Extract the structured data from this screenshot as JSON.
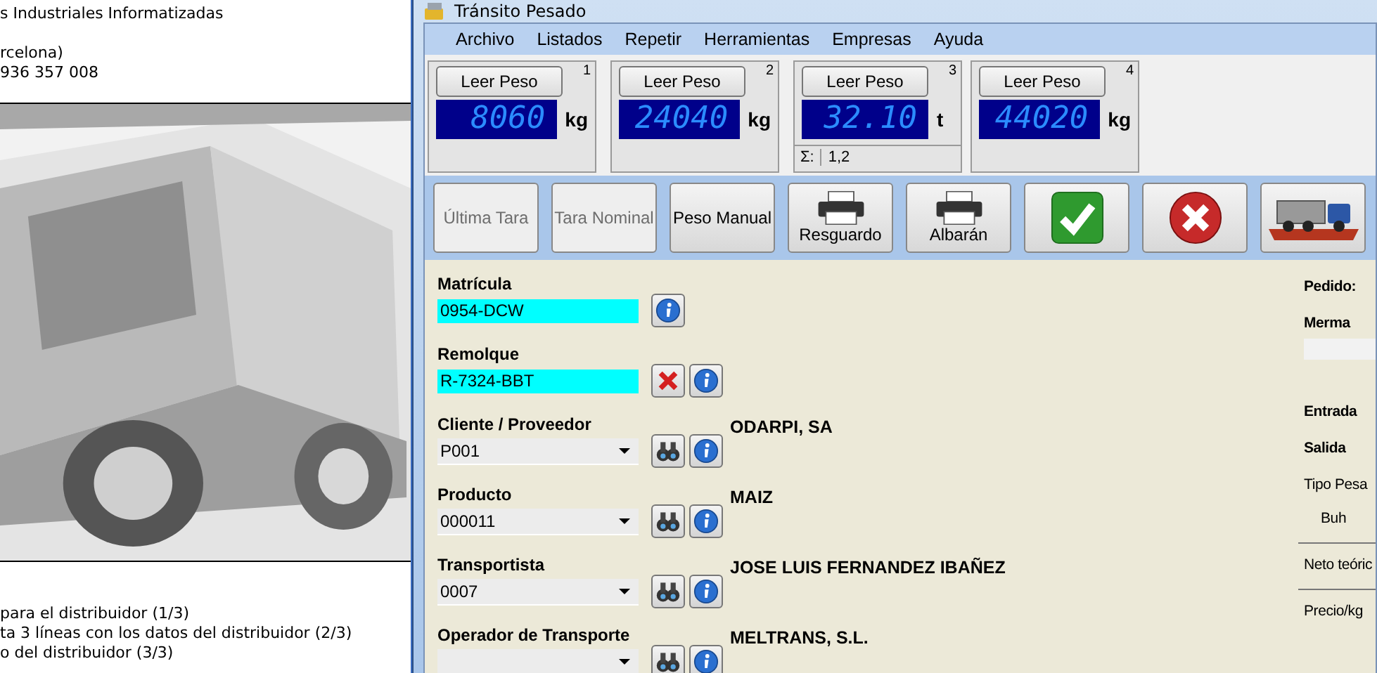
{
  "background_window": {
    "header_lines": [
      "s Industriales Informatizadas",
      "rcelona)",
      "936 357 008"
    ],
    "footer_lines": [
      "para el distribuidor (1/3)",
      "ta 3 líneas con los datos del distribuidor (2/3)",
      "o del distribuidor (3/3)"
    ]
  },
  "window": {
    "title": "Tránsito Pesado"
  },
  "menu": [
    "Archivo",
    "Listados",
    "Repetir",
    "Herramientas",
    "Empresas",
    "Ayuda"
  ],
  "scales": [
    {
      "number": "1",
      "button": "Leer Peso",
      "value": "8060",
      "unit": "kg"
    },
    {
      "number": "2",
      "button": "Leer Peso",
      "value": "24040",
      "unit": "kg"
    },
    {
      "number": "3",
      "button": "Leer Peso",
      "value": "32.10",
      "unit": "t",
      "sum_label": "Σ:",
      "sum_value": "1,2"
    },
    {
      "number": "4",
      "button": "Leer Peso",
      "value": "44020",
      "unit": "kg"
    }
  ],
  "toolbar": [
    {
      "kind": "text",
      "label": "Última Tara",
      "disabled": true
    },
    {
      "kind": "text",
      "label": "Tara Nominal",
      "disabled": true
    },
    {
      "kind": "text",
      "label": "Peso Manual",
      "disabled": false
    },
    {
      "kind": "printer",
      "label": "Resguardo",
      "disabled": false
    },
    {
      "kind": "printer",
      "label": "Albarán",
      "disabled": false
    },
    {
      "kind": "accept",
      "disabled": false
    },
    {
      "kind": "cancel",
      "disabled": false
    },
    {
      "kind": "truck",
      "disabled": false
    }
  ],
  "form": [
    {
      "label": "Matrícula",
      "kind": "plate",
      "value": "0954-DCW",
      "actions": [
        {
          "kind": "info"
        }
      ]
    },
    {
      "label": "Remolque",
      "kind": "plate",
      "value": "R-7324-BBT",
      "actions": [
        {
          "kind": "clear"
        },
        {
          "kind": "info"
        }
      ]
    },
    {
      "label": "Cliente / Proveedor",
      "kind": "combo",
      "value": "P001",
      "actions": [
        {
          "kind": "search"
        },
        {
          "kind": "info"
        }
      ],
      "description": "ODARPI, SA"
    },
    {
      "label": "Producto",
      "kind": "combo",
      "value": "000011",
      "actions": [
        {
          "kind": "search"
        },
        {
          "kind": "info"
        }
      ],
      "description": "MAIZ"
    },
    {
      "label": "Transportista",
      "kind": "combo",
      "value": "0007",
      "actions": [
        {
          "kind": "search"
        },
        {
          "kind": "info"
        }
      ],
      "description": "JOSE LUIS FERNANDEZ IBAÑEZ"
    },
    {
      "label": "Operador de Transporte",
      "kind": "combo",
      "actions": [
        {
          "kind": "search"
        },
        {
          "kind": "info"
        }
      ],
      "description": "MELTRANS, S.L."
    }
  ],
  "side_panel": [
    {
      "kind": "heading",
      "text": "Pedido:"
    },
    {
      "kind": "heading",
      "text": "Merma"
    },
    {
      "kind": "field"
    },
    {
      "kind": "spacer"
    },
    {
      "kind": "heading",
      "text": "Entrada"
    },
    {
      "kind": "heading",
      "text": "Salida"
    },
    {
      "kind": "label",
      "text": "Tipo Pesa"
    },
    {
      "kind": "indented",
      "text": "Buh"
    },
    {
      "kind": "rule"
    },
    {
      "kind": "label",
      "text": "Neto teóric"
    },
    {
      "kind": "rule"
    },
    {
      "kind": "label",
      "text": "Precio/kg"
    }
  ]
}
